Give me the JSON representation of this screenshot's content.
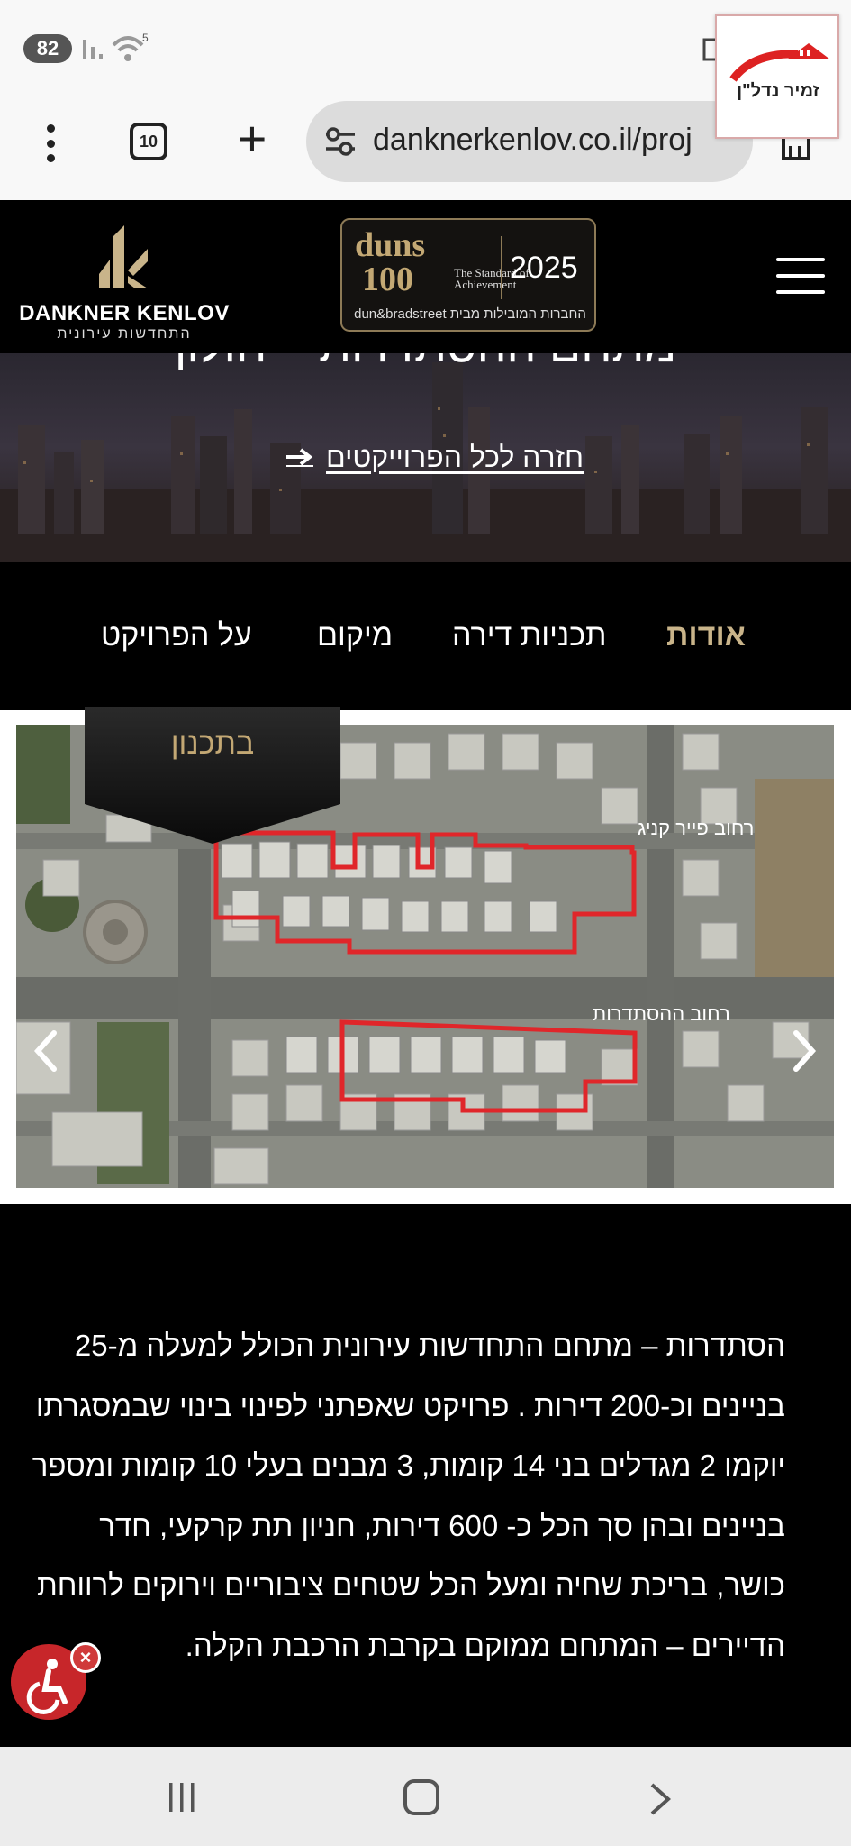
{
  "status_bar": {
    "battery": "82",
    "wifi_badge": "5"
  },
  "browser": {
    "tab_count": "10",
    "url": "danknerkenlov.co.il/proj"
  },
  "watermark": {
    "text": "זמיר נדל\"ן"
  },
  "header": {
    "brand_name": "DANKNER KENLOV",
    "brand_sub": "התחדשות עירונית",
    "badge": {
      "word": "duns",
      "number": "100",
      "tagline": "The Standard of Achievement",
      "year": "2025",
      "bottom": "החברות המובילות מבית dun&bradstreet"
    }
  },
  "hero": {
    "title": "מתחם ההסתדרות – חולון",
    "back_link": "חזרה לכל הפרוייקטים"
  },
  "tabs": [
    {
      "label": "אודות",
      "active": true
    },
    {
      "label": "תכניות דירה",
      "active": false
    },
    {
      "label": "מיקום",
      "active": false
    },
    {
      "label": "על הפרויקט",
      "active": false
    }
  ],
  "gallery": {
    "status": "בתכנון",
    "street_label_1": "רחוב פייר קניג",
    "street_label_2": "רחוב ההסתדרות"
  },
  "description": "הסתדרות – מתחם התחדשות עירונית הכולל למעלה מ-25 בניינים וכ-200 דירות . פרויקט שאפתני לפינוי בינוי שבמסגרתו יוקמו 2 מגדלים בני 14 קומות, 3 מבנים בעלי 10 קומות ומספר בניינים ובהן סך הכל כ- 600 דירות, חניון תת קרקעי, חדר כושר, בריכת שחיה ומעל הכל שטחים ציבוריים וירוקים לרווחת הדיירים – המתחם ממוקם בקרבת הרכבת הקלה.",
  "colors": {
    "accent_gold": "#c9b48a",
    "accessibility_red": "#c7262a",
    "outline_red": "#e0262a"
  }
}
